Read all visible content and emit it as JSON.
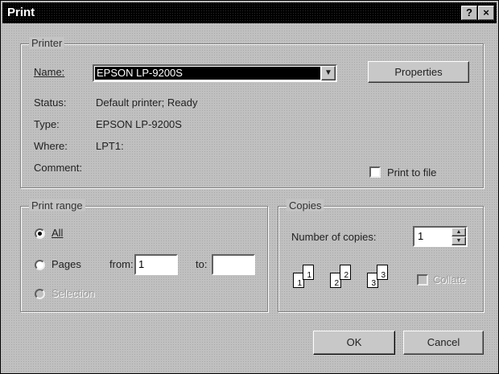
{
  "window": {
    "title": "Print",
    "help_glyph": "?",
    "close_glyph": "×"
  },
  "printer": {
    "legend": "Printer",
    "name_label": "Name:",
    "name_value": "EPSON LP-9200S",
    "properties_label": "Properties",
    "status_label": "Status:",
    "status_value": "Default printer; Ready",
    "type_label": "Type:",
    "type_value": "EPSON LP-9200S",
    "where_label": "Where:",
    "where_value": "LPT1:",
    "comment_label": "Comment:",
    "comment_value": "",
    "print_to_file_label": "Print to file",
    "print_to_file_checked": false
  },
  "print_range": {
    "legend": "Print range",
    "all_label": "All",
    "pages_label": "Pages",
    "from_label": "from:",
    "from_value": "1",
    "to_label": "to:",
    "to_value": "",
    "selection_label": "Selection",
    "selected": "all"
  },
  "copies": {
    "legend": "Copies",
    "number_label": "Number of copies:",
    "number_value": "1",
    "collate_label": "Collate",
    "collate_checked": false,
    "collate_icon_pages": [
      "1",
      "1",
      "2",
      "2",
      "3",
      "3"
    ]
  },
  "buttons": {
    "ok_label": "OK",
    "cancel_label": "Cancel"
  }
}
